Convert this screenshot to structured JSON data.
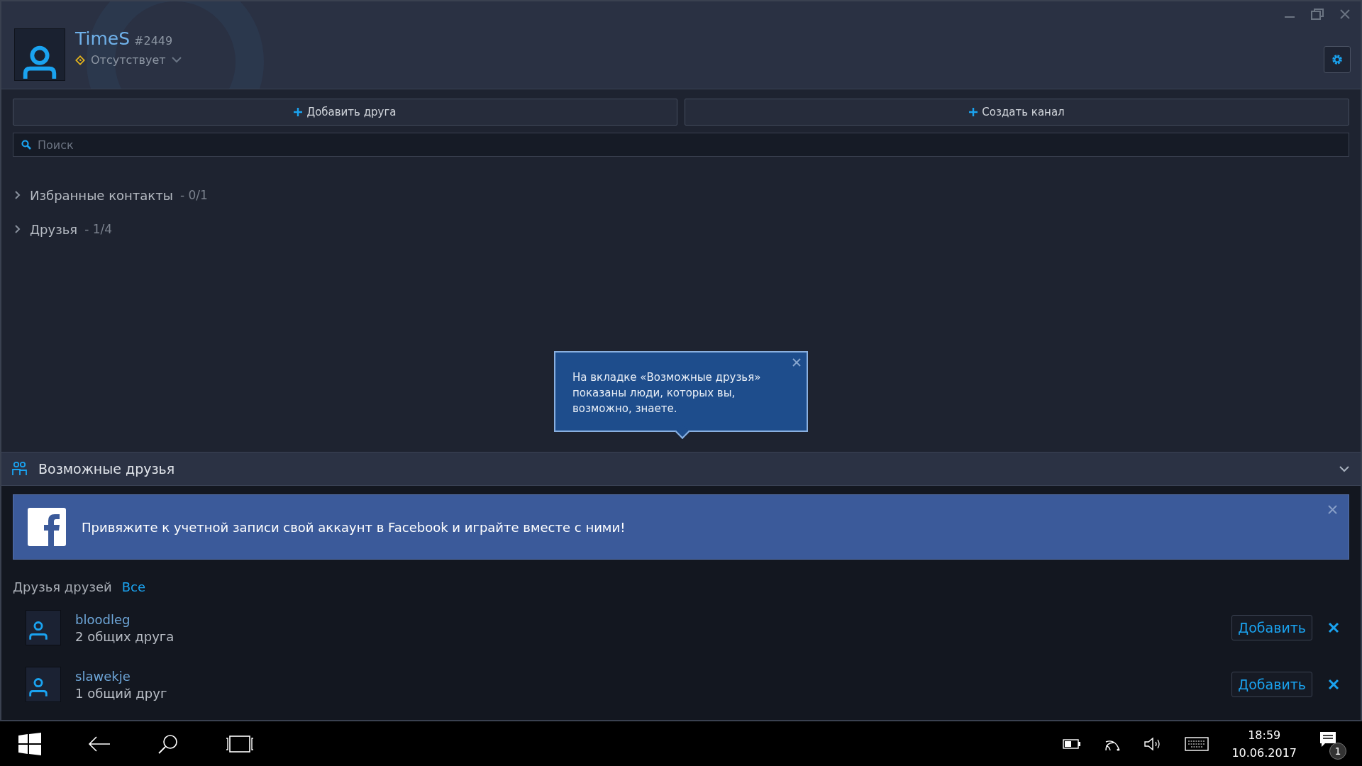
{
  "profile": {
    "name": "TimeS",
    "tag": "#2449",
    "status": "Отсутствует"
  },
  "actions": [
    "Добавить друга",
    "Создать канал"
  ],
  "search": {
    "placeholder": "Поиск"
  },
  "groups": [
    {
      "label": "Избранные контакты",
      "count": "- 0/1",
      "expanded": false
    },
    {
      "label": "Друзья",
      "count": "- 1/4",
      "expanded": false
    }
  ],
  "tooltip": {
    "text": "На вкладке «Возможные друзья» показаны люди, которых вы, возможно, знаете."
  },
  "suggestions": {
    "title": "Возможные друзья",
    "expanded": true,
    "banner": "Привяжите к учетной записи свой аккаунт в Facebook и играйте вместе с ними!",
    "section": "Друзья друзей",
    "link": "Все",
    "people": [
      {
        "name": "bloodleg",
        "mutual": "2 общих друга",
        "action": "Добавить"
      },
      {
        "name": "slawekje",
        "mutual": "1 общий друг",
        "action": "Добавить"
      }
    ]
  },
  "taskbar": {
    "time": "18:59",
    "date": "10.06.2017",
    "notifications": "1"
  }
}
